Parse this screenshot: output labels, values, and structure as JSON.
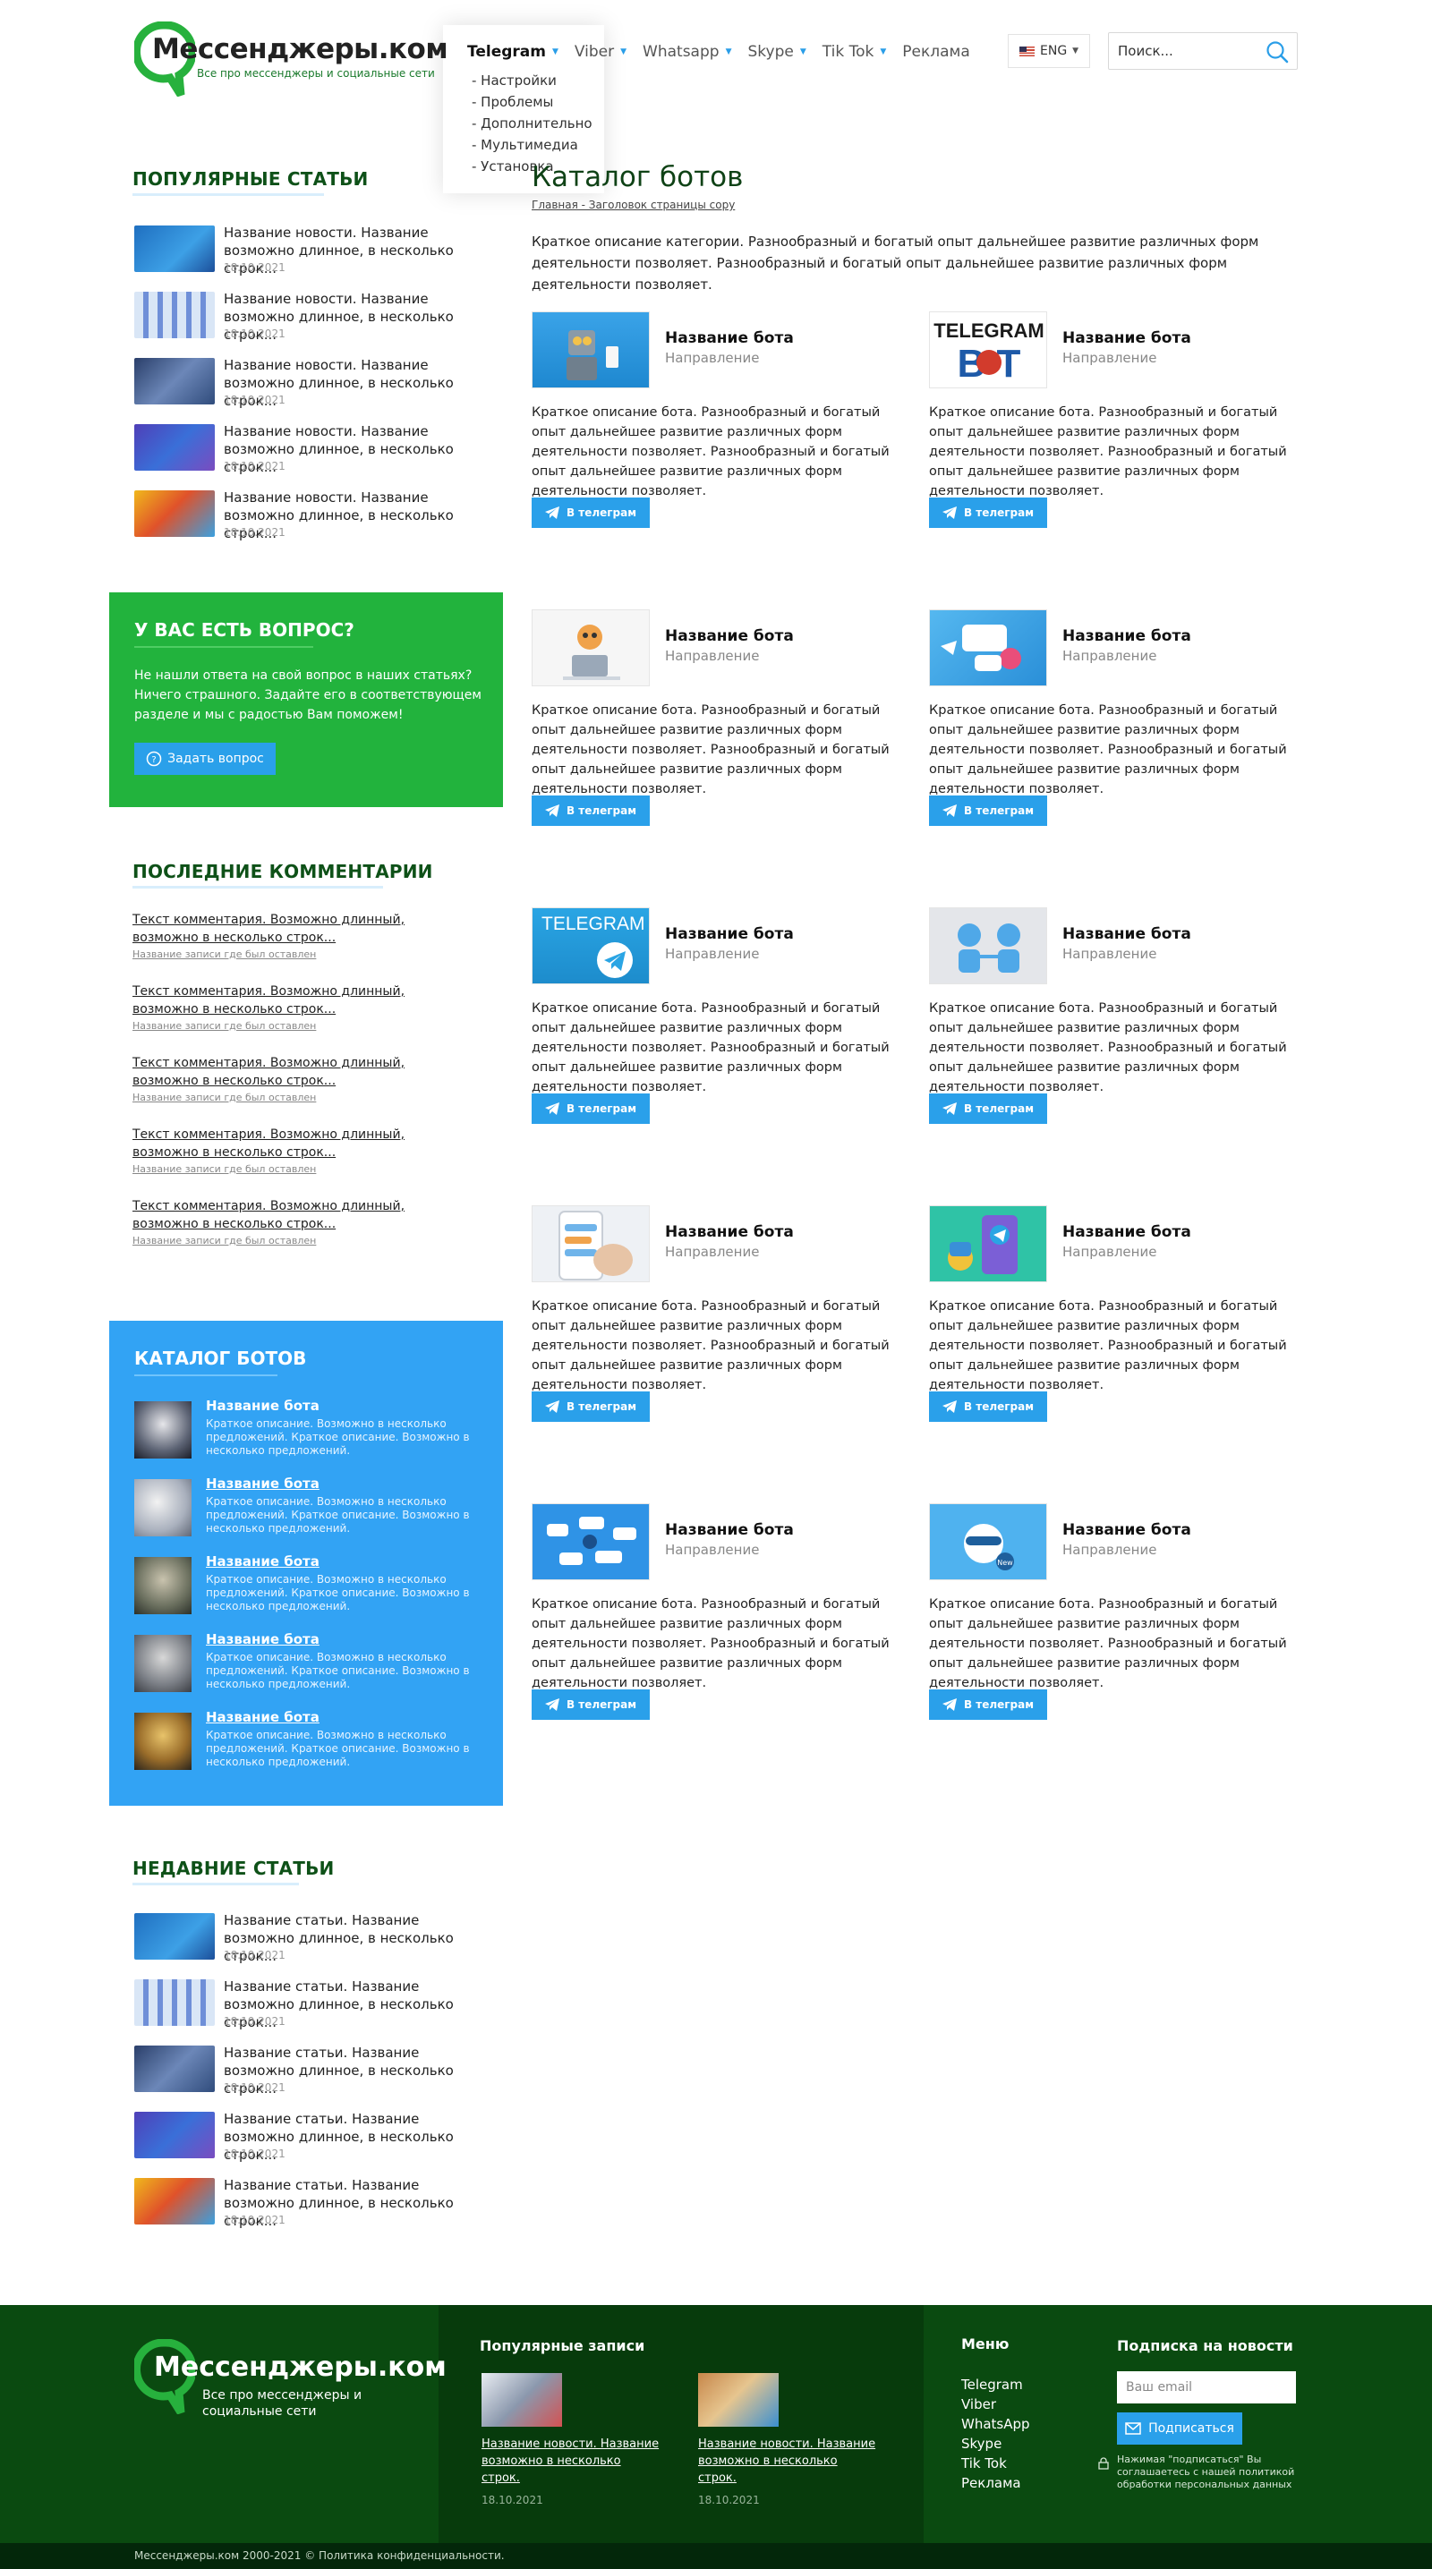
{
  "header": {
    "logo_name": "Мессенджеры.ком",
    "logo_tagline": "Все про мессенджеры и социальные сети",
    "nav": [
      {
        "label": "Telegram",
        "has_caret": true,
        "active": true
      },
      {
        "label": "Viber",
        "has_caret": true
      },
      {
        "label": "Whatsapp",
        "has_caret": true
      },
      {
        "label": "Skype",
        "has_caret": true
      },
      {
        "label": "Tik Tok",
        "has_caret": true
      },
      {
        "label": "Реклама",
        "has_caret": false
      }
    ],
    "dropdown": [
      "- Настройки",
      "- Проблемы",
      "- Дополнительно",
      "- Мультимедиа",
      "- Установка"
    ],
    "lang": "ENG",
    "search_placeholder": "Поиск..."
  },
  "sidebar": {
    "popular_title": "ПОПУЛЯРНЫЕ СТАТЬИ",
    "popular": [
      {
        "title": "Название новости. Название возможно длинное, в несколько строк...",
        "date": "18.10.2021"
      },
      {
        "title": "Название новости. Название возможно длинное, в несколько строк...",
        "date": "18.10.2021"
      },
      {
        "title": "Название новости. Название возможно длинное, в несколько строк...",
        "date": "18.10.2021"
      },
      {
        "title": "Название новости. Название возможно длинное, в несколько строк...",
        "date": "18.10.2021"
      },
      {
        "title": "Название новости. Название возможно длинное, в несколько строк...",
        "date": "18.10.2021"
      }
    ],
    "question": {
      "title": "У ВАС ЕСТЬ ВОПРОС?",
      "text": "Не нашли ответа на свой вопрос в наших статьях? Ничего страшного. Задайте его в соответствующем разделе и мы с радостью Вам поможем!",
      "button": "Задать вопрос"
    },
    "comments_title": "ПОСЛЕДНИЕ КОММЕНТАРИИ",
    "comments": [
      {
        "text": "Текст комментария. Возможно длинный, возможно в несколько строк...",
        "source": "Название записи где был оставлен"
      },
      {
        "text": "Текст комментария. Возможно длинный, возможно в несколько строк...",
        "source": "Название записи где был оставлен"
      },
      {
        "text": "Текст комментария. Возможно длинный, возможно в несколько строк...",
        "source": "Название записи где был оставлен"
      },
      {
        "text": "Текст комментария. Возможно длинный, возможно в несколько строк...",
        "source": "Название записи где был оставлен"
      },
      {
        "text": "Текст комментария. Возможно длинный, возможно в несколько строк...",
        "source": "Название записи где был оставлен"
      }
    ],
    "catalog": {
      "title": "КАТАЛОГ БОТОВ",
      "items": [
        {
          "name": "Название бота",
          "desc": "Краткое описание. Возможно в несколько предложений. Краткое описание. Возможно в несколько предложений."
        },
        {
          "name": "Название бота",
          "desc": "Краткое описание. Возможно в несколько предложений. Краткое описание. Возможно в несколько предложений."
        },
        {
          "name": "Название бота",
          "desc": "Краткое описание. Возможно в несколько предложений. Краткое описание. Возможно в несколько предложений."
        },
        {
          "name": "Название бота",
          "desc": "Краткое описание. Возможно в несколько предложений. Краткое описание. Возможно в несколько предложений."
        },
        {
          "name": "Название бота",
          "desc": "Краткое описание. Возможно в несколько предложений. Краткое описание. Возможно в несколько предложений."
        }
      ]
    },
    "recent_title": "НЕДАВНИЕ СТАТЬИ",
    "recent": [
      {
        "title": "Название статьи. Название возможно длинное, в несколько строк...",
        "date": "18.10.2021"
      },
      {
        "title": "Название статьи. Название возможно длинное, в несколько строк...",
        "date": "18.10.2021"
      },
      {
        "title": "Название статьи. Название возможно длинное, в несколько строк...",
        "date": "18.10.2021"
      },
      {
        "title": "Название статьи. Название возможно длинное, в несколько строк...",
        "date": "18.10.2021"
      },
      {
        "title": "Название статьи. Название возможно длинное, в несколько строк...",
        "date": "18.10.2021"
      }
    ]
  },
  "main": {
    "title": "Каталог ботов",
    "breadcrumb": "Главная - Заголовок страницы copy",
    "intro": "Краткое описание категории. Разнообразный и богатый опыт дальнейшее развитие различных форм деятельности позволяет. Разнообразный и богатый опыт дальнейшее развитие различных форм деятельности позволяет.",
    "bots": [
      {
        "name": "Название бота",
        "direction": "Направление",
        "desc": "Краткое описание бота. Разнообразный и богатый опыт дальнейшее развитие различных форм деятельности позволяет. Разнообразный и богатый опыт дальнейшее развитие различных форм деятельности позволяет.",
        "button": "В телеграм"
      },
      {
        "name": "Название бота",
        "direction": "Направление",
        "desc": "Краткое описание бота. Разнообразный и богатый опыт дальнейшее развитие различных форм деятельности позволяет. Разнообразный и богатый опыт дальнейшее развитие различных форм деятельности позволяет.",
        "button": "В телеграм"
      },
      {
        "name": "Название бота",
        "direction": "Направление",
        "desc": "Краткое описание бота. Разнообразный и богатый опыт дальнейшее развитие различных форм деятельности позволяет. Разнообразный и богатый опыт дальнейшее развитие различных форм деятельности позволяет.",
        "button": "В телеграм"
      },
      {
        "name": "Название бота",
        "direction": "Направление",
        "desc": "Краткое описание бота. Разнообразный и богатый опыт дальнейшее развитие различных форм деятельности позволяет. Разнообразный и богатый опыт дальнейшее развитие различных форм деятельности позволяет.",
        "button": "В телеграм"
      },
      {
        "name": "Название бота",
        "direction": "Направление",
        "desc": "Краткое описание бота. Разнообразный и богатый опыт дальнейшее развитие различных форм деятельности позволяет. Разнообразный и богатый опыт дальнейшее развитие различных форм деятельности позволяет.",
        "button": "В телеграм",
        "image_text": "TELEGRAM"
      },
      {
        "name": "Название бота",
        "direction": "Направление",
        "desc": "Краткое описание бота. Разнообразный и богатый опыт дальнейшее развитие различных форм деятельности позволяет. Разнообразный и богатый опыт дальнейшее развитие различных форм деятельности позволяет.",
        "button": "В телеграм"
      },
      {
        "name": "Название бота",
        "direction": "Направление",
        "desc": "Краткое описание бота. Разнообразный и богатый опыт дальнейшее развитие различных форм деятельности позволяет. Разнообразный и богатый опыт дальнейшее развитие различных форм деятельности позволяет.",
        "button": "В телеграм"
      },
      {
        "name": "Название бота",
        "direction": "Направление",
        "desc": "Краткое описание бота. Разнообразный и богатый опыт дальнейшее развитие различных форм деятельности позволяет. Разнообразный и богатый опыт дальнейшее развитие различных форм деятельности позволяет.",
        "button": "В телеграм"
      },
      {
        "name": "Название бота",
        "direction": "Направление",
        "desc": "Краткое описание бота. Разнообразный и богатый опыт дальнейшее развитие различных форм деятельности позволяет. Разнообразный и богатый опыт дальнейшее развитие различных форм деятельности позволяет.",
        "button": "В телеграм"
      },
      {
        "name": "Название бота",
        "direction": "Направление",
        "desc": "Краткое описание бота. Разнообразный и богатый опыт дальнейшее развитие различных форм деятельности позволяет. Разнообразный и богатый опыт дальнейшее развитие различных форм деятельности позволяет.",
        "button": "В телеграм"
      }
    ]
  },
  "footer": {
    "logo_name": "Мессенджеры.ком",
    "logo_tagline": "Все про мессенджеры и социальные сети",
    "popular_title": "Популярные записи",
    "posts": [
      {
        "title": "Название новости. Название возможно в несколько строк.",
        "date": "18.10.2021"
      },
      {
        "title": "Название новости. Название возможно в несколько строк.",
        "date": "18.10.2021"
      }
    ],
    "menu_title": "Меню",
    "menu": [
      "Telegram",
      "Viber",
      "WhatsApp",
      "Skype",
      "Tik Tok",
      "Реклама"
    ],
    "subscribe_title": "Подписка на новости",
    "email_placeholder": "Ваш email",
    "subscribe_button": "Подписаться",
    "consent": "Нажимая \"подписаться\" Вы соглашаетесь с нашей политикой обработки персональных данных",
    "copyright": "Мессенджеры.ком 2000-2021 © Политика конфиденциальности."
  },
  "colors": {
    "brand_green": "#22b33d",
    "dark_green": "#0a4a10",
    "accent_blue": "#2aa0ea",
    "catalog_blue": "#32a3f4"
  }
}
